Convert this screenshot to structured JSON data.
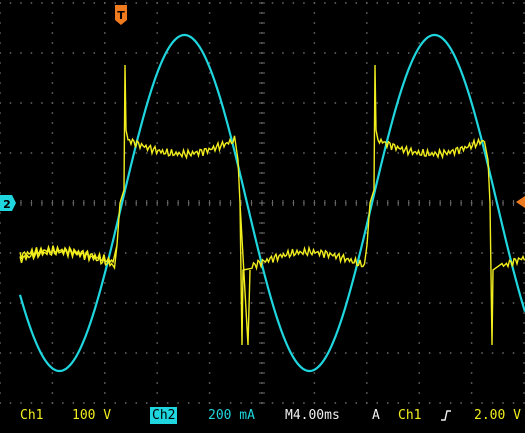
{
  "colors": {
    "background": "#000000",
    "grid": "#6a6a6a",
    "ch1": "#f2ee1e",
    "ch2": "#1fd6de",
    "trigger_marker": "#f07a1e"
  },
  "markers": {
    "trigger_top": "T",
    "ch2_ground": "2"
  },
  "status": {
    "ch1_label": "Ch1",
    "ch1_scale": "100 V",
    "ch2_label": "Ch2",
    "ch2_scale": "200 mA",
    "timebase": "M4.00ms",
    "trigger_mode": "A",
    "trigger_source": "Ch1",
    "trigger_slope_icon": "rising-edge-icon",
    "trigger_level": "2.00 V"
  }
}
